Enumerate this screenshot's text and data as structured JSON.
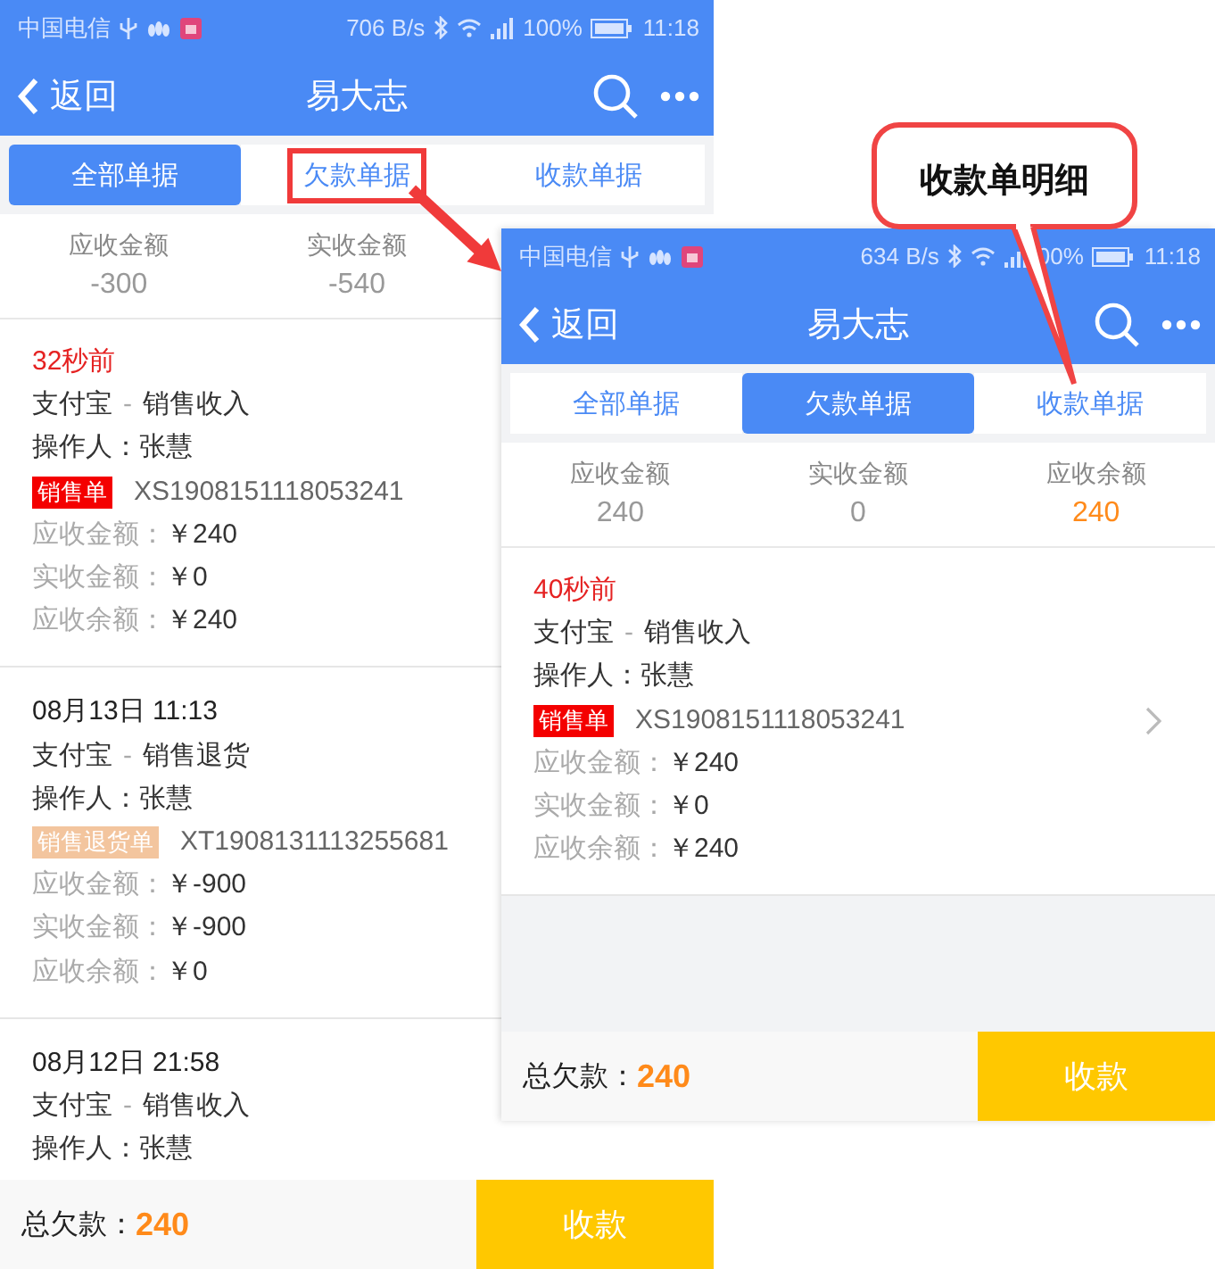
{
  "phones": [
    {
      "status_bar": {
        "carrier": "中国电信",
        "speed": "706 B/s",
        "battery": "100%",
        "time": "11:18"
      },
      "nav": {
        "back": "返回",
        "title": "易大志"
      },
      "tabs": [
        {
          "label": "全部单据",
          "selected": true,
          "outlined": false
        },
        {
          "label": "欠款单据",
          "selected": false,
          "outlined": true
        },
        {
          "label": "收款单据",
          "selected": false,
          "outlined": false
        }
      ],
      "summary": [
        {
          "label": "应收金额",
          "value": "-300",
          "highlight": false
        },
        {
          "label": "实收金额",
          "value": "-540",
          "highlight": false
        }
      ],
      "records": [
        {
          "time": "32秒前",
          "recent": true,
          "method": "支付宝",
          "separator": "-",
          "category": "销售收入",
          "operator": "操作人：张慧",
          "tag": {
            "text": "销售单",
            "kind": "sale"
          },
          "number": "XS1908151118053241",
          "amounts": [
            {
              "label": "应收金额：",
              "value": "￥240"
            },
            {
              "label": "实收金额：",
              "value": "￥0"
            },
            {
              "label": "应收余额：",
              "value": "￥240"
            }
          ]
        },
        {
          "time": "08月13日 11:13",
          "recent": false,
          "method": "支付宝",
          "separator": "-",
          "category": "销售退货",
          "operator": "操作人：张慧",
          "tag": {
            "text": "销售退货单",
            "kind": "return"
          },
          "number": "XT1908131113255681",
          "amounts": [
            {
              "label": "应收金额：",
              "value": "￥-900"
            },
            {
              "label": "实收金额：",
              "value": "￥-900"
            },
            {
              "label": "应收余额：",
              "value": "￥0"
            }
          ]
        },
        {
          "time": "08月12日 21:58",
          "recent": false,
          "method": "支付宝",
          "separator": "-",
          "category": "销售收入",
          "operator": "操作人：张慧"
        }
      ],
      "footer": {
        "label": "总欠款：",
        "value": "240",
        "button": "收款"
      }
    },
    {
      "status_bar": {
        "carrier": "中国电信",
        "speed": "634 B/s",
        "battery": "00%",
        "time": "11:18"
      },
      "nav": {
        "back": "返回",
        "title": "易大志"
      },
      "tabs": [
        {
          "label": "全部单据",
          "selected": false,
          "outlined": false
        },
        {
          "label": "欠款单据",
          "selected": true,
          "outlined": false
        },
        {
          "label": "收款单据",
          "selected": false,
          "outlined": false
        }
      ],
      "summary": [
        {
          "label": "应收金额",
          "value": "240",
          "highlight": false
        },
        {
          "label": "实收金额",
          "value": "0",
          "highlight": false
        },
        {
          "label": "应收余额",
          "value": "240",
          "highlight": true
        }
      ],
      "records": [
        {
          "time": "40秒前",
          "recent": true,
          "has_detail": true,
          "method": "支付宝",
          "separator": "-",
          "category": "销售收入",
          "operator": "操作人：张慧",
          "tag": {
            "text": "销售单",
            "kind": "sale"
          },
          "number": "XS1908151118053241",
          "amounts": [
            {
              "label": "应收金额：",
              "value": "￥240"
            },
            {
              "label": "实收金额：",
              "value": "￥0"
            },
            {
              "label": "应收余额：",
              "value": "￥240"
            }
          ]
        }
      ],
      "footer": {
        "label": "总欠款：",
        "value": "240",
        "button": "收款"
      }
    }
  ],
  "callout": {
    "text": "收款单明细"
  }
}
